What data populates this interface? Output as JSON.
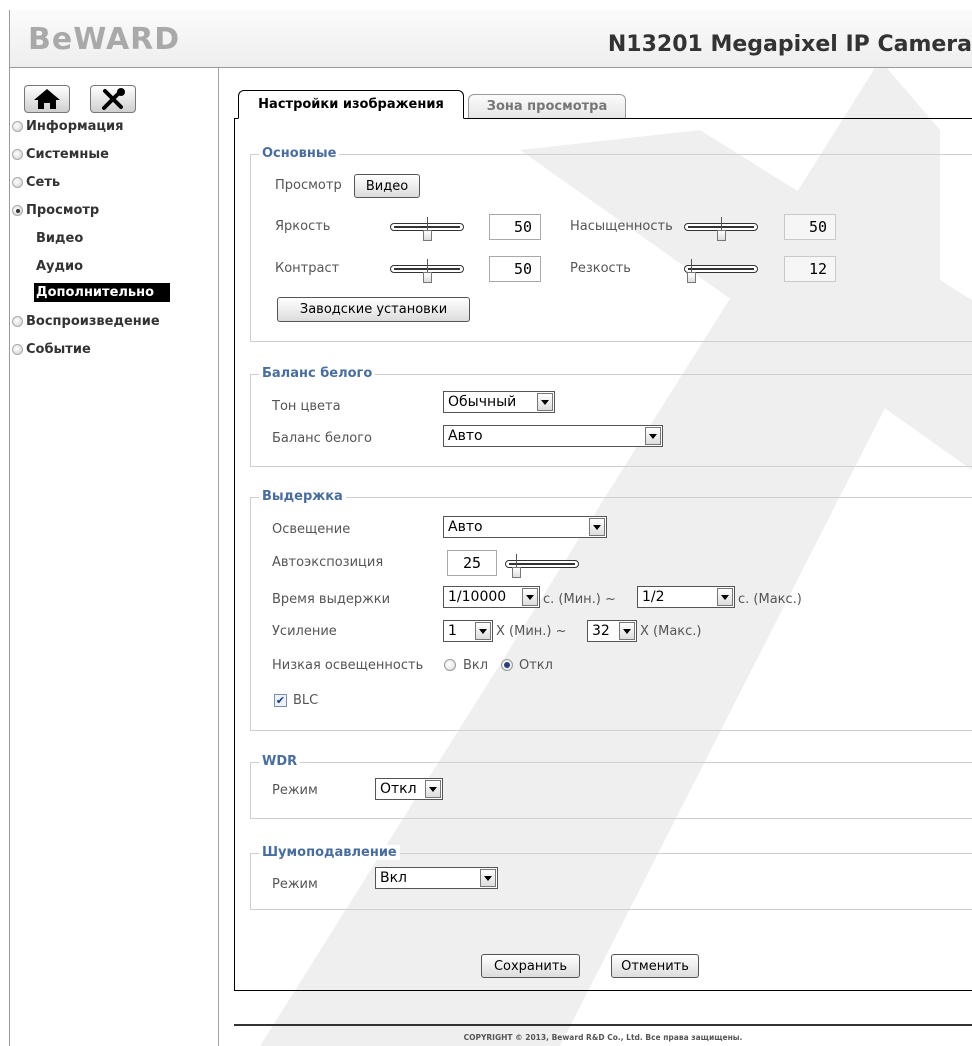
{
  "header": {
    "logo": "BeWARD",
    "camera_title": "N13201 Megapixel IP Camera"
  },
  "sidebar": {
    "icons": [
      "home-icon",
      "tools-icon"
    ],
    "items": [
      {
        "label": "Информация",
        "active": false
      },
      {
        "label": "Системные",
        "active": false
      },
      {
        "label": "Сеть",
        "active": false
      },
      {
        "label": "Просмотр",
        "active": true
      },
      {
        "label": "Воспроизведение",
        "active": false
      },
      {
        "label": "Событие",
        "active": false
      }
    ],
    "subitems": [
      {
        "label": "Видео",
        "selected": false
      },
      {
        "label": "Аудио",
        "selected": false
      },
      {
        "label": "Дополнительно",
        "selected": true
      }
    ]
  },
  "tabs": [
    {
      "label": "Настройки изображения",
      "active": true
    },
    {
      "label": "Зона просмотра",
      "active": false
    }
  ],
  "basic": {
    "legend": "Основные",
    "preview_label": "Просмотр",
    "video_button": "Видео",
    "brightness_label": "Яркость",
    "brightness_value": "50",
    "brightness_level": 0.5,
    "saturation_label": "Насыщенность",
    "saturation_value": "50",
    "saturation_level": 0.5,
    "contrast_label": "Контраст",
    "contrast_value": "50",
    "contrast_level": 0.5,
    "sharpness_label": "Резкость",
    "sharpness_value": "12",
    "sharpness_level": 0.05,
    "factory_button": "Заводские установки"
  },
  "white_balance": {
    "legend": "Баланс белого",
    "tone_label": "Тон цвета",
    "tone_value": "Обычный",
    "wb_label": "Баланс белого",
    "wb_value": "Авто"
  },
  "exposure": {
    "legend": "Выдержка",
    "lighting_label": "Освещение",
    "lighting_value": "Авто",
    "ae_label": "Автоэкспозиция",
    "ae_value": "25",
    "ae_level": 0.1,
    "shutter_label": "Время выдержки",
    "shutter_min": "1/10000",
    "shutter_min_unit": "с.  (Мин.) ~",
    "shutter_max": "1/2",
    "shutter_max_unit": "с.  (Макс.)",
    "gain_label": "Усиление",
    "gain_min": "1",
    "gain_min_unit": "X  (Мин.) ~",
    "gain_max": "32",
    "gain_max_unit": "X  (Макс.)",
    "lowlight_label": "Низкая освещенность",
    "lowlight_on": "Вкл",
    "lowlight_off": "Откл",
    "lowlight_selected": "Откл",
    "blc_label": "BLC",
    "blc_checked": true
  },
  "wdr": {
    "legend": "WDR",
    "mode_label": "Режим",
    "mode_value": "Откл"
  },
  "noise": {
    "legend": "Шумоподавление",
    "mode_label": "Режим",
    "mode_value": "Вкл"
  },
  "actions": {
    "save": "Сохранить",
    "cancel": "Отменить"
  },
  "footer": {
    "copyright": "COPYRIGHT © 2013, Beward R&D Co., Ltd. Все права защищены."
  }
}
